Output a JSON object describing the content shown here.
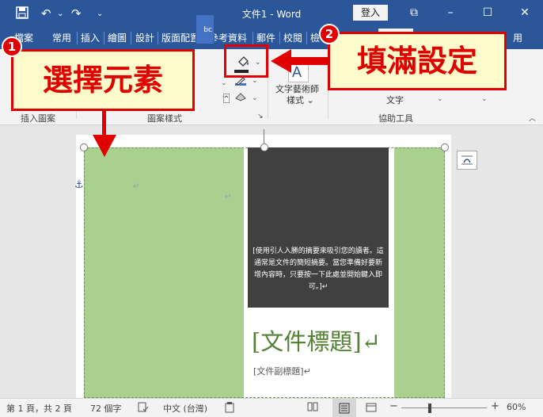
{
  "window": {
    "title": "文件1  -  Word",
    "login_label": "登入",
    "min_glyph": "–",
    "max_glyph": "☐",
    "close_glyph": "✕",
    "restore_glyph": "⧉"
  },
  "quick_access": {
    "save_icon": "save-icon",
    "undo_glyph": "↶",
    "undo_drop": "⌄",
    "redo_glyph": "↷",
    "custom_glyph": "⌄"
  },
  "tabs": {
    "file": "檔案",
    "home": "常用",
    "insert": "插入",
    "draw": "繪圖",
    "design": "設計",
    "layout": "版面配置",
    "references": "參考資料",
    "mailings": "郵件",
    "review": "校閱",
    "view": "檢",
    "format_tail": "用"
  },
  "ribbon": {
    "group_insert_shapes": "插入圖案",
    "group_shape_styles": "圖案樣式",
    "group_accessibility": "協助工具",
    "shape_style_label": "bc",
    "wordart_line1": "文字藝術師",
    "wordart_line2": "樣式 ⌄",
    "alt_text_label": "文字",
    "chevron": "⌄",
    "collapse_glyph": "︿",
    "dialog_launcher": "↘"
  },
  "document": {
    "summary": "[使用引人入勝的摘要來吸引您的讀者。這通常是文件的簡短摘要。當您準備好要新增內容時，只要按一下此處並開始鍵入即可。]↵",
    "title": "[文件標題]↵",
    "subtitle": "[文件副標題]↵",
    "para_mark": "↵",
    "anchor_glyph": "⚓"
  },
  "status": {
    "pages": "第 1 頁，共 2 頁",
    "words": "72 個字",
    "language": "中文 (台灣)",
    "zoom": "60%",
    "zoom_minus": "−",
    "zoom_plus": "+"
  },
  "callouts": {
    "select_element": "選擇元素",
    "fill_settings": "填滿設定",
    "badge_1": "1",
    "badge_2": "2"
  },
  "colors": {
    "titlebar": "#2b579a",
    "shape_fill": "#a9d08e",
    "title_text": "#548235",
    "callout_border": "#e00000",
    "callout_fill": "#fffccc"
  }
}
